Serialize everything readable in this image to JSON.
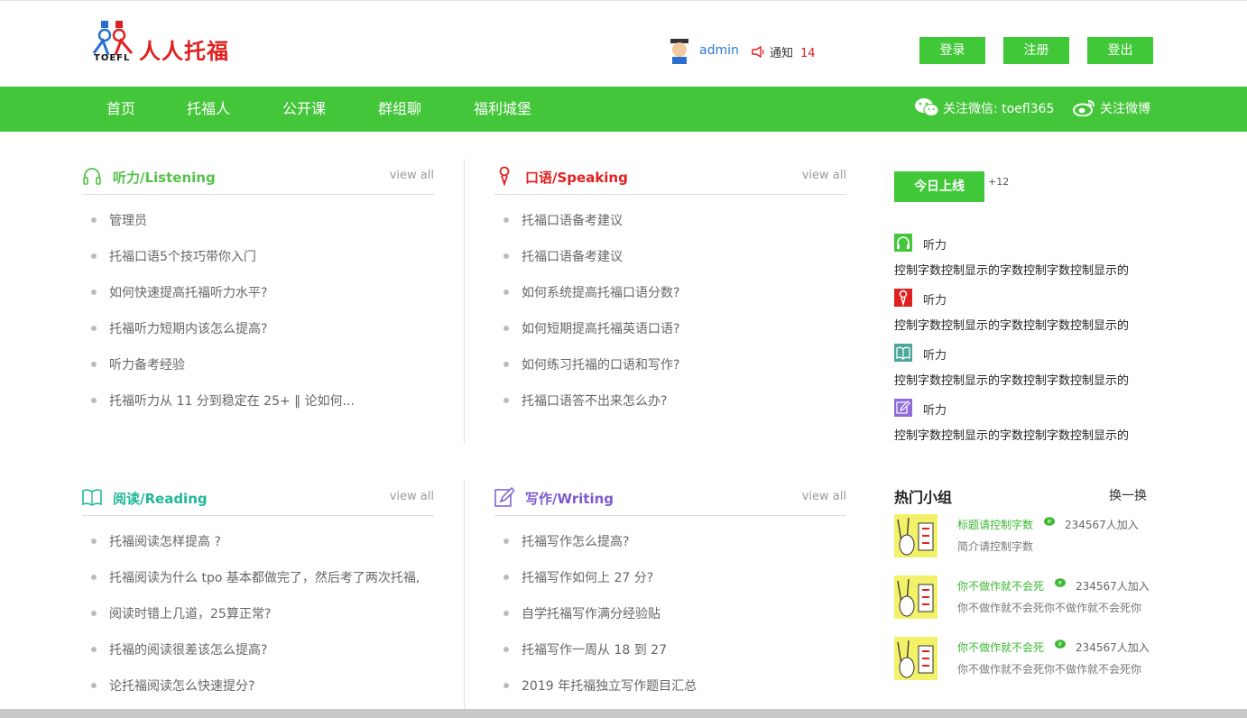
{
  "header": {
    "logo_text": "人人托福",
    "logo_sub": "TOEFL",
    "username": "admin",
    "notice_label": "通知",
    "notice_count": "14",
    "login": "登录",
    "register": "注册",
    "logout": "登出"
  },
  "nav": {
    "items": [
      "首页",
      "托福人",
      "公开课",
      "群组聊",
      "福利城堡"
    ],
    "wechat": "关注微信: toefl365",
    "weibo": "关注微博",
    "bg_color": "#44c63a"
  },
  "panels": {
    "listening": {
      "title": "听力/Listening",
      "color": "#55c24a",
      "view_all": "view all",
      "items": [
        "管理员",
        "托福口语5个技巧带你入门",
        "如何快速提高托福听力水平?",
        "托福听力短期内该怎么提高?",
        "听力备考经验",
        "托福听力从 11 分到稳定在 25+ ‖ 论如何..."
      ]
    },
    "speaking": {
      "title": "口语/Speaking",
      "color": "#e02020",
      "view_all": "view all",
      "items": [
        "托福口语备考建议",
        "托福口语备考建议",
        "如何系统提高托福口语分数?",
        "如何短期提高托福英语口语?",
        "如何练习托福的口语和写作?",
        "托福口语答不出来怎么办?"
      ]
    },
    "reading": {
      "title": "阅读/Reading",
      "color": "#21b79a",
      "view_all": "view all",
      "items": [
        "托福阅读怎样提高 ?",
        "托福阅读为什么 tpo 基本都做完了，然后考了两次托福,",
        "阅读时错上几道，25算正常?",
        "托福的阅读很差该怎么提高?",
        "论托福阅读怎么快速提分?"
      ]
    },
    "writing": {
      "title": "写作/Writing",
      "color": "#7b5bd0",
      "view_all": "view all",
      "items": [
        "托福写作怎么提高?",
        "托福写作如何上 27 分?",
        "自学托福写作满分经验贴",
        "托福写作一周从 18 到 27",
        "2019 年托福独立写作题目汇总"
      ]
    }
  },
  "online": {
    "button": "今日上线",
    "count": "+12",
    "feed": [
      {
        "icon": "headphones-icon",
        "color": "#44c63a",
        "label": "听力",
        "text": "控制字数控制显示的字数控制字数控制显示的"
      },
      {
        "icon": "microphone-icon",
        "color": "#e02020",
        "label": "听力",
        "text": "控制字数控制显示的字数控制字数控制显示的"
      },
      {
        "icon": "book-icon",
        "color": "#4aa89a",
        "label": "听力",
        "text": "控制字数控制显示的字数控制字数控制显示的"
      },
      {
        "icon": "pencil-icon",
        "color": "#8f6ad8",
        "label": "听力",
        "text": "控制字数控制显示的字数控制字数控制显示的"
      }
    ]
  },
  "hot_groups": {
    "title": "热门小组",
    "switch": "换一换",
    "groups": [
      {
        "name": "标题请控制字数",
        "joined": "234567人加入",
        "desc": "简介请控制字数"
      },
      {
        "name": "你不做作就不会死",
        "joined": "234567人加入",
        "desc": "你不做作就不会死你不做作就不会死你"
      },
      {
        "name": "你不做作就不会死",
        "joined": "234567人加入",
        "desc": "你不做作就不会死你不做作就不会死你"
      }
    ]
  }
}
